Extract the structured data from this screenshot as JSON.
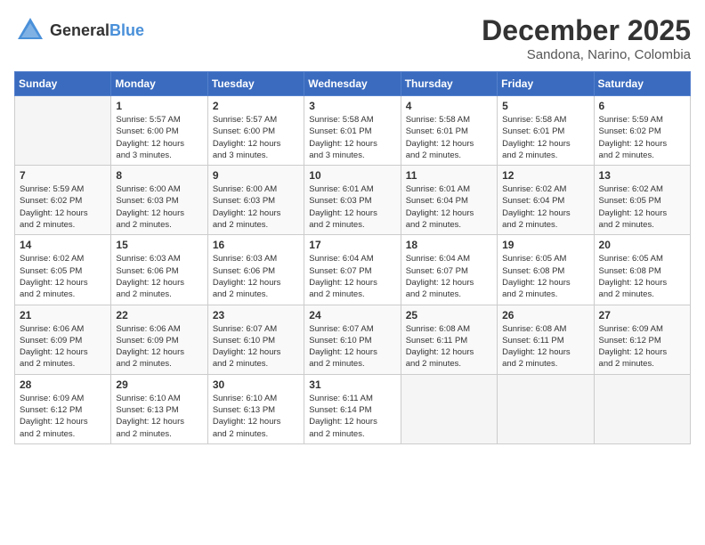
{
  "header": {
    "logo": {
      "general": "General",
      "blue": "Blue"
    },
    "month": "December 2025",
    "location": "Sandona, Narino, Colombia"
  },
  "calendar": {
    "weekdays": [
      "Sunday",
      "Monday",
      "Tuesday",
      "Wednesday",
      "Thursday",
      "Friday",
      "Saturday"
    ],
    "weeks": [
      [
        {
          "day": "",
          "info": ""
        },
        {
          "day": "1",
          "info": "Sunrise: 5:57 AM\nSunset: 6:00 PM\nDaylight: 12 hours\nand 3 minutes."
        },
        {
          "day": "2",
          "info": "Sunrise: 5:57 AM\nSunset: 6:00 PM\nDaylight: 12 hours\nand 3 minutes."
        },
        {
          "day": "3",
          "info": "Sunrise: 5:58 AM\nSunset: 6:01 PM\nDaylight: 12 hours\nand 3 minutes."
        },
        {
          "day": "4",
          "info": "Sunrise: 5:58 AM\nSunset: 6:01 PM\nDaylight: 12 hours\nand 2 minutes."
        },
        {
          "day": "5",
          "info": "Sunrise: 5:58 AM\nSunset: 6:01 PM\nDaylight: 12 hours\nand 2 minutes."
        },
        {
          "day": "6",
          "info": "Sunrise: 5:59 AM\nSunset: 6:02 PM\nDaylight: 12 hours\nand 2 minutes."
        }
      ],
      [
        {
          "day": "7",
          "info": "Sunrise: 5:59 AM\nSunset: 6:02 PM\nDaylight: 12 hours\nand 2 minutes."
        },
        {
          "day": "8",
          "info": "Sunrise: 6:00 AM\nSunset: 6:03 PM\nDaylight: 12 hours\nand 2 minutes."
        },
        {
          "day": "9",
          "info": "Sunrise: 6:00 AM\nSunset: 6:03 PM\nDaylight: 12 hours\nand 2 minutes."
        },
        {
          "day": "10",
          "info": "Sunrise: 6:01 AM\nSunset: 6:03 PM\nDaylight: 12 hours\nand 2 minutes."
        },
        {
          "day": "11",
          "info": "Sunrise: 6:01 AM\nSunset: 6:04 PM\nDaylight: 12 hours\nand 2 minutes."
        },
        {
          "day": "12",
          "info": "Sunrise: 6:02 AM\nSunset: 6:04 PM\nDaylight: 12 hours\nand 2 minutes."
        },
        {
          "day": "13",
          "info": "Sunrise: 6:02 AM\nSunset: 6:05 PM\nDaylight: 12 hours\nand 2 minutes."
        }
      ],
      [
        {
          "day": "14",
          "info": "Sunrise: 6:02 AM\nSunset: 6:05 PM\nDaylight: 12 hours\nand 2 minutes."
        },
        {
          "day": "15",
          "info": "Sunrise: 6:03 AM\nSunset: 6:06 PM\nDaylight: 12 hours\nand 2 minutes."
        },
        {
          "day": "16",
          "info": "Sunrise: 6:03 AM\nSunset: 6:06 PM\nDaylight: 12 hours\nand 2 minutes."
        },
        {
          "day": "17",
          "info": "Sunrise: 6:04 AM\nSunset: 6:07 PM\nDaylight: 12 hours\nand 2 minutes."
        },
        {
          "day": "18",
          "info": "Sunrise: 6:04 AM\nSunset: 6:07 PM\nDaylight: 12 hours\nand 2 minutes."
        },
        {
          "day": "19",
          "info": "Sunrise: 6:05 AM\nSunset: 6:08 PM\nDaylight: 12 hours\nand 2 minutes."
        },
        {
          "day": "20",
          "info": "Sunrise: 6:05 AM\nSunset: 6:08 PM\nDaylight: 12 hours\nand 2 minutes."
        }
      ],
      [
        {
          "day": "21",
          "info": "Sunrise: 6:06 AM\nSunset: 6:09 PM\nDaylight: 12 hours\nand 2 minutes."
        },
        {
          "day": "22",
          "info": "Sunrise: 6:06 AM\nSunset: 6:09 PM\nDaylight: 12 hours\nand 2 minutes."
        },
        {
          "day": "23",
          "info": "Sunrise: 6:07 AM\nSunset: 6:10 PM\nDaylight: 12 hours\nand 2 minutes."
        },
        {
          "day": "24",
          "info": "Sunrise: 6:07 AM\nSunset: 6:10 PM\nDaylight: 12 hours\nand 2 minutes."
        },
        {
          "day": "25",
          "info": "Sunrise: 6:08 AM\nSunset: 6:11 PM\nDaylight: 12 hours\nand 2 minutes."
        },
        {
          "day": "26",
          "info": "Sunrise: 6:08 AM\nSunset: 6:11 PM\nDaylight: 12 hours\nand 2 minutes."
        },
        {
          "day": "27",
          "info": "Sunrise: 6:09 AM\nSunset: 6:12 PM\nDaylight: 12 hours\nand 2 minutes."
        }
      ],
      [
        {
          "day": "28",
          "info": "Sunrise: 6:09 AM\nSunset: 6:12 PM\nDaylight: 12 hours\nand 2 minutes."
        },
        {
          "day": "29",
          "info": "Sunrise: 6:10 AM\nSunset: 6:13 PM\nDaylight: 12 hours\nand 2 minutes."
        },
        {
          "day": "30",
          "info": "Sunrise: 6:10 AM\nSunset: 6:13 PM\nDaylight: 12 hours\nand 2 minutes."
        },
        {
          "day": "31",
          "info": "Sunrise: 6:11 AM\nSunset: 6:14 PM\nDaylight: 12 hours\nand 2 minutes."
        },
        {
          "day": "",
          "info": ""
        },
        {
          "day": "",
          "info": ""
        },
        {
          "day": "",
          "info": ""
        }
      ]
    ]
  }
}
